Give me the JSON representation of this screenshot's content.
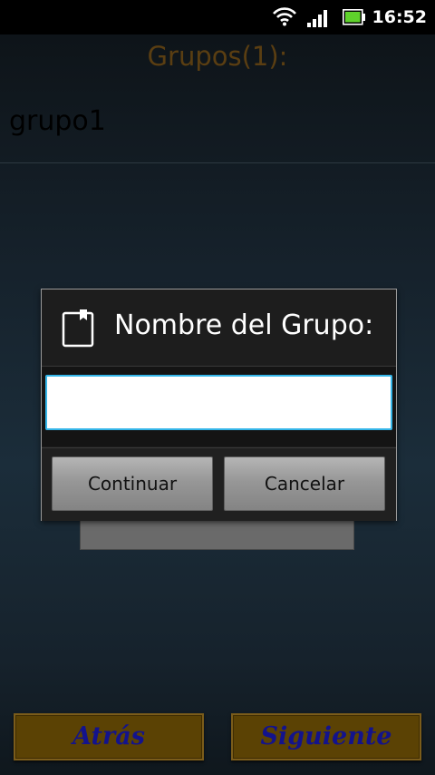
{
  "status_bar": {
    "time": "16:52",
    "icons": [
      "wifi-icon",
      "signal-icon",
      "battery-icon"
    ]
  },
  "header": {
    "title": "Grupos(1):"
  },
  "list": {
    "items": [
      {
        "label": "grupo1"
      }
    ]
  },
  "dialog": {
    "title": "Nombre del Grupo:",
    "icon": "notebook-icon",
    "input_value": "",
    "buttons": {
      "continue_label": "Continuar",
      "cancel_label": "Cancelar"
    }
  },
  "footer": {
    "back_label": "Atrás",
    "next_label": "Siguiente"
  },
  "colors": {
    "title": "#5a3e12",
    "input_focus": "#35b6e9",
    "nav_button_bg": "#5b4204",
    "nav_button_text": "#13138c"
  }
}
